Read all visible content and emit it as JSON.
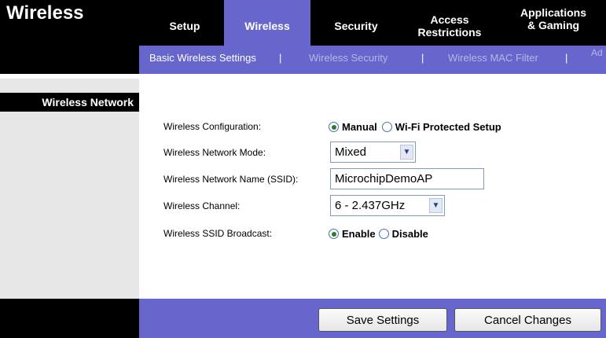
{
  "header": {
    "title": "Wireless",
    "tabs": [
      {
        "label": "Setup"
      },
      {
        "label": "Wireless"
      },
      {
        "label": "Security"
      },
      {
        "label_line1": "Access",
        "label_line2": "Restrictions"
      },
      {
        "label_line1": "Applications",
        "label_line2": "& Gaming"
      }
    ]
  },
  "subnav": {
    "items": [
      "Basic Wireless Settings",
      "Wireless Security",
      "Wireless MAC Filter"
    ],
    "separator": "|",
    "overflow_text": "Ad"
  },
  "section": {
    "title": "Wireless Network"
  },
  "form": {
    "config_label": "Wireless Configuration:",
    "config_options": [
      "Manual",
      "Wi-Fi Protected Setup"
    ],
    "config_selected": "Manual",
    "mode_label": "Wireless Network Mode:",
    "mode_value": "Mixed",
    "ssid_label": "Wireless Network Name (SSID):",
    "ssid_value": "MicrochipDemoAP",
    "channel_label": "Wireless Channel:",
    "channel_value": "6 - 2.437GHz",
    "broadcast_label": "Wireless SSID Broadcast:",
    "broadcast_options": [
      "Enable",
      "Disable"
    ],
    "broadcast_selected": "Enable"
  },
  "footer": {
    "save_label": "Save Settings",
    "cancel_label": "Cancel Changes"
  },
  "colors": {
    "accent_purple": "#6666cc",
    "header_black": "#000000",
    "radio_selected": "#2a7d2a"
  }
}
